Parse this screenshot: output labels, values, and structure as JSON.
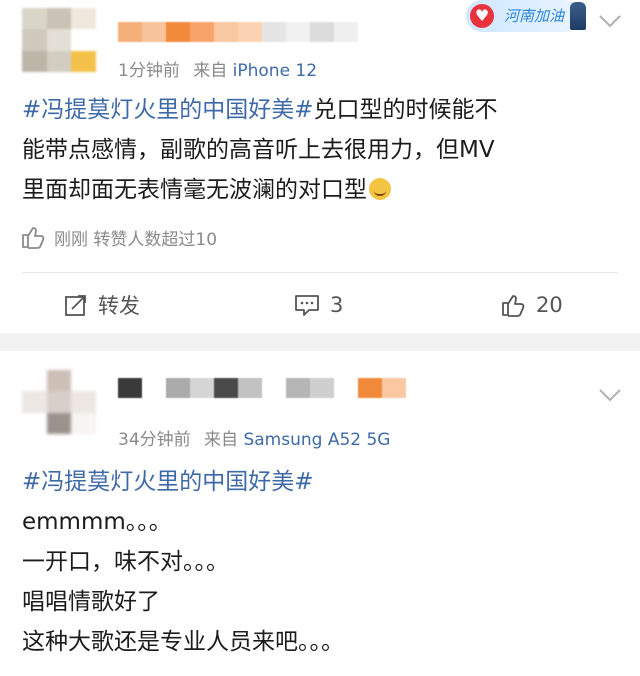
{
  "post1": {
    "time": "1分钟前",
    "from_label": "来自",
    "device": "iPhone 12",
    "badge": "河南加油",
    "topic": "#冯提莫灯火里的中国好美#",
    "text_line1": "兑口型的时候能不",
    "text_line2": "能带点感情，副歌的高音听上去很用力，但MV",
    "text_line3": "里面却面无表情毫无波澜的对口型",
    "likes_text": "刚刚 转赞人数超过10",
    "actions": {
      "repost": "转发",
      "comments": "3",
      "likes": "20"
    }
  },
  "post2": {
    "time": "34分钟前",
    "from_label": "来自",
    "device": "Samsung A52 5G",
    "topic": "#冯提莫灯火里的中国好美#",
    "lines": [
      "emmmm。。。",
      "一开口，味不对。。。",
      "唱唱情歌好了",
      "这种大歌还是专业人员来吧。。。"
    ]
  },
  "icons": [
    "chevron-down-icon",
    "thumb-up-icon",
    "repost-icon",
    "comment-icon",
    "emoji-icon",
    "heart-icon"
  ],
  "colors": {
    "topic_link": "#3f6aa8",
    "meta_gray": "#8a8a8a",
    "separator": "#f2f2f2",
    "badge_text": "#2d86e0"
  }
}
